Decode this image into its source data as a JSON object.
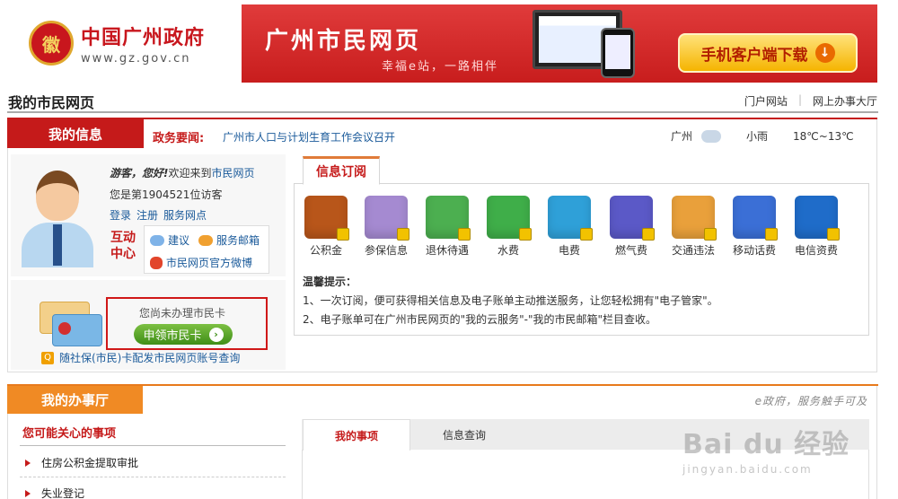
{
  "header": {
    "logo_name": "中国广州政府",
    "logo_url": "www.gz.gov.cn",
    "emblem_text": "徽",
    "banner_title": "广州市民网页",
    "banner_slogan": "幸福e站，一路相伴",
    "download_label": "手机客户端下载",
    "download_arrow": "↓"
  },
  "page": {
    "title": "我的市民网页",
    "links": [
      "门户网站",
      "网上办事大厅"
    ],
    "link_sep": "|"
  },
  "info": {
    "tab_label": "我的信息",
    "news_label": "政务要闻:",
    "news_text": "广州市人口与计划生育工作会议召开",
    "weather": {
      "city": "广州",
      "condition": "小雨",
      "temp": "18℃~13℃"
    }
  },
  "user": {
    "guest": "游客，您好!",
    "welcome": "欢迎来到",
    "site_link": "市民网页",
    "visitor_text": "您是第1904521位访客",
    "links": [
      "登录",
      "注册",
      "服务网点"
    ],
    "interact_label": "互动中心",
    "interact_items": [
      "建议",
      "服务邮箱",
      "市民网页官方微博"
    ]
  },
  "card": {
    "note": "您尚未办理市民卡",
    "apply_label": "申领市民卡",
    "apply_arrow": "›",
    "query_icon": "Q",
    "query_text": "随社保(市民)卡配发市民网页账号查询"
  },
  "subscribe": {
    "tab_label": "信息订阅",
    "services": [
      {
        "label": "公积金",
        "icon": "house-icon",
        "color": "#b8561a"
      },
      {
        "label": "参保信息",
        "icon": "handshake-icon",
        "color": "#a58ad1"
      },
      {
        "label": "退休待遇",
        "icon": "elder-icon",
        "color": "#4caf50"
      },
      {
        "label": "水费",
        "icon": "faucet-icon",
        "color": "#3fae49"
      },
      {
        "label": "电费",
        "icon": "bulb-icon",
        "color": "#2fa0d8"
      },
      {
        "label": "燃气费",
        "icon": "flame-icon",
        "color": "#5b59c7"
      },
      {
        "label": "交通违法",
        "icon": "car-icon",
        "color": "#e9a03b"
      },
      {
        "label": "移动话费",
        "icon": "mobile-icon",
        "color": "#3b6fd6"
      },
      {
        "label": "电信资费",
        "icon": "telecom-icon",
        "color": "#1f6cc9"
      }
    ],
    "tips_title": "温馨提示：",
    "tips": [
      "1、一次订阅，便可获得相关信息及电子账单主动推送服务，让您轻松拥有\"电子管家\"。",
      "2、电子账单可在广州市民网页的\"我的云服务\"-\"我的市民邮箱\"栏目查收。"
    ]
  },
  "office": {
    "tab_label": "我的办事厅",
    "slogan": "e政府，服务触手可及",
    "concern_title": "您可能关心的事项",
    "concern_items": [
      "住房公积金提取审批",
      "失业登记"
    ],
    "tabs": [
      "我的事项",
      "信息查询"
    ]
  },
  "watermark": {
    "big": "Bai du 经验",
    "small": "jingyan.baidu.com"
  }
}
